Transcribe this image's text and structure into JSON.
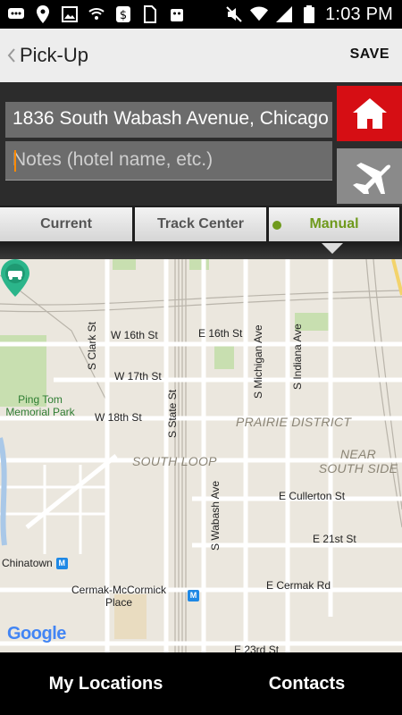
{
  "status_bar": {
    "time": "1:03 PM",
    "left_icons": [
      "messages-icon",
      "location-icon",
      "gallery-icon",
      "shield-wifi-icon",
      "dollar-icon",
      "sim-icon",
      "robot-icon"
    ],
    "right_icons": [
      "mute-icon",
      "wifi-icon",
      "signal-icon",
      "battery-icon"
    ]
  },
  "app_bar": {
    "title": "Pick-Up",
    "save_label": "SAVE"
  },
  "address": {
    "value": "1836 South Wabash Avenue, Chicago",
    "notes_placeholder": "Notes (hotel name, etc.)"
  },
  "quick_buttons": {
    "home_color": "#d60e14",
    "airport_color": "#8a8a8a"
  },
  "tabs": {
    "current": "Current",
    "track_center": "Track Center",
    "manual": "Manual",
    "selected": "Manual",
    "accent": "#6f9a1c"
  },
  "map": {
    "labels": {
      "w16": "W 16th St",
      "e16": "E 16th St",
      "w17": "W 17th St",
      "w18": "W 18th St",
      "s_clark": "S Clark St",
      "s_state": "S State St",
      "s_michigan": "S Michigan Ave",
      "s_indiana": "S Indiana Ave",
      "s_wabash": "S Wabash Ave",
      "ping_tom": "Ping Tom\nMemorial Park",
      "prairie": "PRAIRIE DISTRICT",
      "south_loop": "SOUTH LOOP",
      "near_south": "NEAR\nSOUTH SIDE",
      "cullerton": "E Cullerton St",
      "e21": "E 21st St",
      "chinatown": "Chinatown",
      "cermak_mccormick": "Cermak-McCormick\nPlace",
      "e_cermak": "E Cermak Rd",
      "e23": "E 23rd St",
      "metro_glyph": "M"
    },
    "attribution": "Google"
  },
  "bottom_nav": {
    "my_locations": "My Locations",
    "contacts": "Contacts"
  }
}
